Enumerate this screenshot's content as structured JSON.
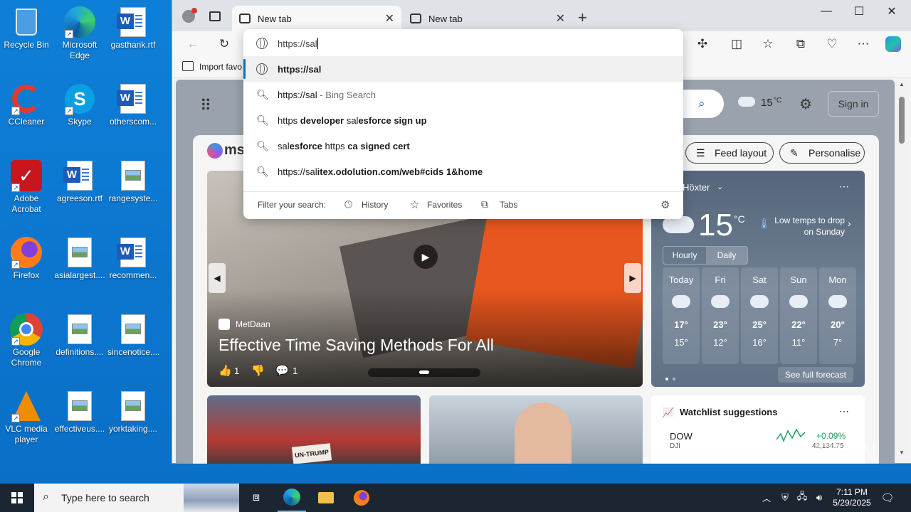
{
  "desktop": {
    "icons": [
      {
        "label": "Recycle Bin",
        "icon": "recycle-bin-icon"
      },
      {
        "label": "Microsoft Edge",
        "icon": "edge-icon"
      },
      {
        "label": "gasthank.rtf",
        "icon": "word-doc-icon"
      },
      {
        "label": "CCleaner",
        "icon": "ccleaner-icon"
      },
      {
        "label": "Skype",
        "icon": "skype-icon"
      },
      {
        "label": "otherscom...",
        "icon": "word-doc-icon"
      },
      {
        "label": "Adobe Acrobat",
        "icon": "acrobat-icon"
      },
      {
        "label": "agreeson.rtf",
        "icon": "word-doc-icon"
      },
      {
        "label": "rangesyste...",
        "icon": "image-file-icon"
      },
      {
        "label": "Firefox",
        "icon": "firefox-icon"
      },
      {
        "label": "asialargest....",
        "icon": "image-file-icon"
      },
      {
        "label": "recommen...",
        "icon": "word-doc-icon"
      },
      {
        "label": "Google Chrome",
        "icon": "chrome-icon"
      },
      {
        "label": "definitions....",
        "icon": "image-file-icon"
      },
      {
        "label": "sincenotice....",
        "icon": "image-file-icon"
      },
      {
        "label": "VLC media player",
        "icon": "vlc-icon"
      },
      {
        "label": "effectiveus....",
        "icon": "image-file-icon"
      },
      {
        "label": "yorktaking....",
        "icon": "image-file-icon"
      }
    ]
  },
  "browser": {
    "tabs": [
      {
        "label": "New tab",
        "active": true
      },
      {
        "label": "New tab",
        "active": false
      }
    ],
    "favbar_label": "Import favo",
    "omnibox": {
      "value": "https://sal",
      "suggestions": [
        {
          "pre": "",
          "bold": "https://sal",
          "post": "",
          "muted": "",
          "icon": "globe-icon",
          "selected": true
        },
        {
          "pre": "https://sal",
          "bold": "",
          "post": "",
          "muted": " - Bing Search",
          "icon": "search-icon",
          "selected": false
        },
        {
          "pre": "https ",
          "bold": "developer ",
          "post": "sal",
          "bold2": "esforce sign up",
          "muted": "",
          "icon": "search-icon",
          "selected": false
        },
        {
          "pre": "sal",
          "bold": "esforce",
          "post": " https ",
          "bold2": "ca signed cert",
          "muted": "",
          "icon": "search-icon",
          "selected": false
        },
        {
          "pre": "https://sal",
          "bold": "itex.odolution.com/web#cids 1&home",
          "post": "",
          "muted": "",
          "icon": "search-icon",
          "selected": false
        }
      ],
      "filter_label": "Filter your search:",
      "filters": [
        "History",
        "Favorites",
        "Tabs"
      ]
    },
    "newtab": {
      "temperature_small": "15",
      "temp_unit": "°C",
      "sign_in": "Sign in",
      "feed_layout": "Feed layout",
      "personalise": "Personalise",
      "brand_partial": "ms",
      "hero": {
        "source": "MetDaan",
        "title": "Effective Time Saving Methods For All",
        "likes": "1",
        "comments": "1"
      },
      "weather": {
        "location": "Höxter",
        "temp": "15",
        "unit": "°C",
        "alert": "Low temps to drop on Sunday",
        "tabs": [
          "Hourly",
          "Daily"
        ],
        "days": [
          {
            "name": "Today",
            "hi": "17°",
            "lo": "15°"
          },
          {
            "name": "Fri",
            "hi": "23°",
            "lo": "12°"
          },
          {
            "name": "Sat",
            "hi": "25°",
            "lo": "16°"
          },
          {
            "name": "Sun",
            "hi": "22°",
            "lo": "11°"
          },
          {
            "name": "Mon",
            "hi": "20°",
            "lo": "7°"
          }
        ],
        "forecast_link": "See full forecast"
      },
      "watchlist": {
        "title": "Watchlist suggestions",
        "symbol": "DOW",
        "sub": "DJI",
        "change": "+0.09%",
        "value": "42,134.75"
      }
    }
  },
  "taskbar": {
    "search_placeholder": "Type here to search",
    "time": "7:11 PM",
    "date": "5/29/2025"
  },
  "watermark": "ANY RUN"
}
